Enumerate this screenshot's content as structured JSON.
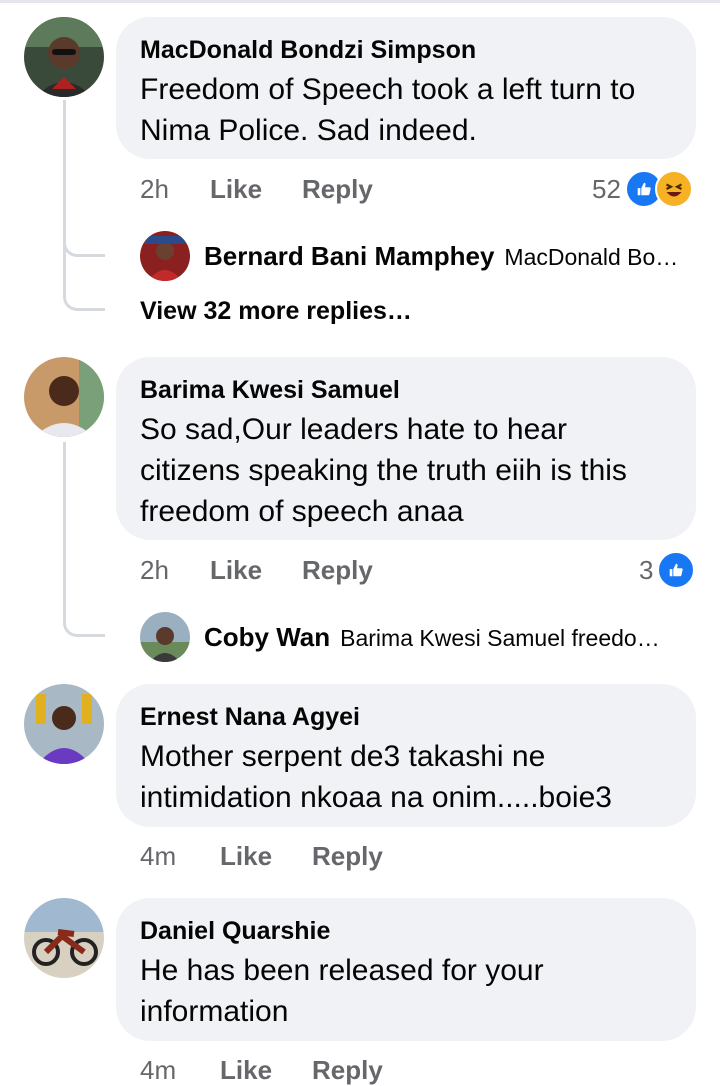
{
  "comments": [
    {
      "author": "MacDonald Bondzi Simpson",
      "text": "Freedom of Speech took a left turn to Nima Police. Sad indeed.",
      "time": "2h",
      "like_label": "Like",
      "reply_label": "Reply",
      "reaction_count": "52",
      "reactions": [
        "like-icon",
        "haha-icon"
      ],
      "reply_preview": {
        "author": "Bernard Bani Mamphey",
        "text": "MacDonald Bo…"
      },
      "view_more": "View 32 more replies…"
    },
    {
      "author": "Barima Kwesi Samuel",
      "text": "So sad,Our leaders hate to hear citizens speaking the truth eiih is this freedom of speech anaa",
      "time": "2h",
      "like_label": "Like",
      "reply_label": "Reply",
      "reaction_count": "3",
      "reactions": [
        "like-icon"
      ],
      "reply_preview": {
        "author": "Coby Wan",
        "text": "Barima Kwesi Samuel freedo…"
      }
    },
    {
      "author": "Ernest Nana Agyei",
      "text": "Mother serpent de3 takashi ne intimidation nkoaa na onim.....boie3",
      "time": "4m",
      "like_label": "Like",
      "reply_label": "Reply"
    },
    {
      "author": "Daniel Quarshie",
      "text": "He has been released for your information",
      "time": "4m",
      "like_label": "Like",
      "reply_label": "Reply"
    }
  ],
  "colors": {
    "bubble": "#f0f2f5",
    "meta": "#65676b",
    "like_blue": "#1877f2",
    "haha_yellow": "#f7b125"
  }
}
